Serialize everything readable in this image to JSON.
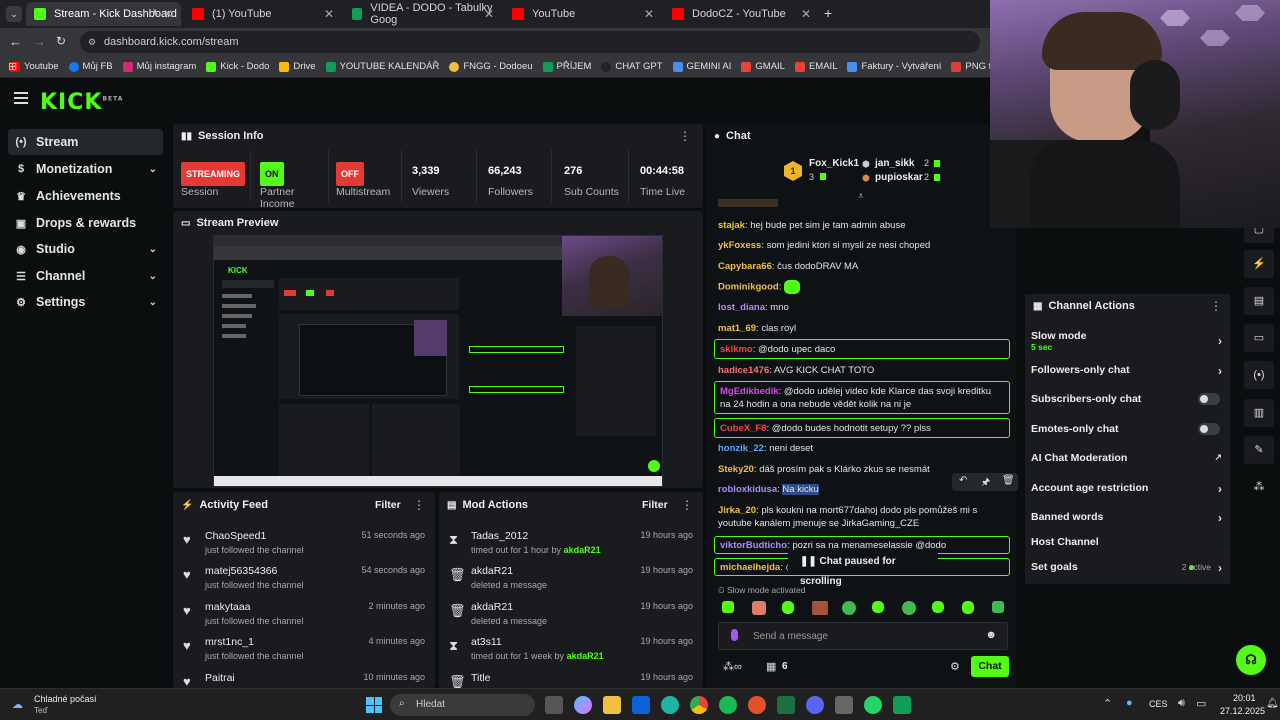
{
  "browser": {
    "tabs": [
      {
        "label": "Stream - Kick Dashboard",
        "color": "#53fc18"
      },
      {
        "label": "(1) YouTube",
        "color": "#ff0000"
      },
      {
        "label": "VIDEA - DODO - Tabulky Goog",
        "color": "#0f9d58"
      },
      {
        "label": "YouTube",
        "color": "#ff0000"
      },
      {
        "label": "DodoCZ - YouTube",
        "color": "#ff0000"
      }
    ],
    "url": "dashboard.kick.com/stream",
    "bookmarks": [
      "Youtube",
      "Můj FB",
      "Můj instagram",
      "Kick - Dodo",
      "Drive",
      "YOUTUBE KALENDÁŘ",
      "FNGG - Dodoeu",
      "PŘÍJEM",
      "CHAT GPT",
      "GEMINI AI",
      "GMAIL",
      "EMAIL",
      "Faktury - Vytváření",
      "PNG to PDF",
      "ht"
    ]
  },
  "logo": {
    "text": "KICK",
    "badge": "BETA"
  },
  "sidebar": {
    "items": [
      {
        "label": "Stream",
        "icon": "stream-icon"
      },
      {
        "label": "Monetization",
        "icon": "dollar-icon"
      },
      {
        "label": "Achievements",
        "icon": "trophy-icon"
      },
      {
        "label": "Drops & rewards",
        "icon": "gift-icon"
      },
      {
        "label": "Studio",
        "icon": "palette-icon"
      },
      {
        "label": "Channel",
        "icon": "channel-icon"
      },
      {
        "label": "Settings",
        "icon": "gear-icon"
      }
    ]
  },
  "session": {
    "title": "Session Info",
    "streaming": {
      "value": "STREAMING",
      "label": "Session"
    },
    "partner": {
      "value": "ON",
      "label": "Partner Income"
    },
    "multistream": {
      "value": "OFF",
      "label": "Multistream"
    },
    "viewers": {
      "value": "3,339",
      "label": "Viewers"
    },
    "followers": {
      "value": "66,243",
      "label": "Followers"
    },
    "subs": {
      "value": "276",
      "label": "Sub Counts"
    },
    "time": {
      "value": "00:44:58",
      "label": "Time Live"
    }
  },
  "preview": {
    "title": "Stream Preview"
  },
  "activity": {
    "title": "Activity Feed",
    "filter": "Filter",
    "rows": [
      {
        "name": "ChaoSpeed1",
        "sub": "just followed the channel",
        "time": "51 seconds ago"
      },
      {
        "name": "matej56354366",
        "sub": "just followed the channel",
        "time": "54 seconds ago"
      },
      {
        "name": "makytaaa",
        "sub": "just followed the channel",
        "time": "2 minutes ago"
      },
      {
        "name": "mrst1nc_1",
        "sub": "just followed the channel",
        "time": "4 minutes ago"
      },
      {
        "name": "Paitrai",
        "sub": "",
        "time": "10 minutes ago"
      }
    ]
  },
  "mod": {
    "title": "Mod Actions",
    "filter": "Filter",
    "rows": [
      {
        "name": "Tadas_2012",
        "sub": "timed out for 1 hour by",
        "by": "akdaR21",
        "time": "19 hours ago",
        "icon": "hourglass-icon"
      },
      {
        "name": "akdaR21",
        "sub": "deleted a message",
        "by": "",
        "time": "19 hours ago",
        "icon": "trash-icon"
      },
      {
        "name": "akdaR21",
        "sub": "deleted a message",
        "by": "",
        "time": "19 hours ago",
        "icon": "trash-icon"
      },
      {
        "name": "at3s11",
        "sub": "timed out for 1 week by",
        "by": "akdaR21",
        "time": "19 hours ago",
        "icon": "hourglass-icon"
      },
      {
        "name": "Title",
        "sub": "",
        "by": "",
        "time": "19 hours ago",
        "icon": "trash-icon"
      }
    ]
  },
  "chat": {
    "title": "Chat",
    "leaders": {
      "first": {
        "rank": "1",
        "name": "Fox_Kick1",
        "count": "3"
      },
      "second": {
        "name": "jan_sikk",
        "count": "2"
      },
      "third": {
        "name": "pupioskar",
        "count": "2"
      }
    },
    "messages": [
      {
        "user": "stajak",
        "color": "#f0c040",
        "text": "hej bude pet sim je tam admin abuse"
      },
      {
        "user": "ykFoxess",
        "color": "#f0c040",
        "text": "som jedini ktori si mysli ze nesi choped"
      },
      {
        "user": "Capybara66",
        "color": "#f0c040",
        "text": "čus dodoDRAV MA"
      },
      {
        "user": "Dominikgood",
        "color": "#f0c040",
        "text": ""
      },
      {
        "user": "lost_diana",
        "color": "#c084fc",
        "text": "mno"
      },
      {
        "user": "mat1_69",
        "color": "#f0c040",
        "text": "clas royl"
      },
      {
        "user": "skikmo",
        "color": "#ef4444",
        "text": "@dodo upec daco"
      },
      {
        "user": "hadice1476",
        "color": "#f87171",
        "text": "AVG KICK CHAT TOTO"
      },
      {
        "user": "MgEdikbedik",
        "color": "#d946ef",
        "text": "@dodo udělej video kde Klarce das svoji kreditku na 24 hodin a ona nebude vědět kolik na ni je"
      },
      {
        "user": "CubeX_F8",
        "color": "#ef4444",
        "text": "@dodo budes hodnotit setupy ?? plss"
      },
      {
        "user": "honzik_22",
        "color": "#60a5fa",
        "text": "neni deset"
      },
      {
        "user": "Steky20",
        "color": "#f0c040",
        "text": "dáš prosím pak s Klárko zkus se nesmát"
      },
      {
        "user": "robloxkidusa",
        "color": "#a78bfa",
        "text": "Na kicku"
      },
      {
        "user": "Jirka_20",
        "color": "#f0c040",
        "text": "pls koukni na mort677dahoj dodo pls pomůžeš mi s youtube kanálem jmenuje se JirkaGaming_CZE"
      },
      {
        "user": "viktorBudticho",
        "color": "#a78bfa",
        "text": "pozri sa na menameselassie @dodo"
      },
      {
        "user": "michaelhejda",
        "color": "#f0c040",
        "text": "@c"
      }
    ],
    "paused": "Chat paused for scrolling",
    "slowmode": "Slow mode activated",
    "placeholder": "Send a message",
    "viewers_count": "6",
    "chat_button": "Chat"
  },
  "actions": {
    "title": "Channel Actions",
    "items": [
      {
        "label": "Slow mode",
        "sub": "5 sec",
        "type": "chev"
      },
      {
        "label": "Followers-only chat",
        "sub": "",
        "type": "chev"
      },
      {
        "label": "Subscribers-only chat",
        "sub": "",
        "type": "toggle"
      },
      {
        "label": "Emotes-only chat",
        "sub": "",
        "type": "toggle"
      },
      {
        "label": "AI Chat Moderation",
        "sub": "",
        "type": "ext"
      },
      {
        "label": "Account age restriction",
        "sub": "",
        "type": "chev"
      },
      {
        "label": "Banned words",
        "sub": "",
        "type": "chev"
      },
      {
        "label": "Host Channel",
        "sub": "",
        "type": "none"
      },
      {
        "label": "Set goals",
        "sub": "",
        "type": "chev",
        "badge": "2 active"
      }
    ]
  },
  "taskbar": {
    "weather": "Chladné počasí",
    "weather_sub": "Teď",
    "search": "Hledat",
    "lang": "CES",
    "time": "20:01",
    "date": "27.12.2025"
  },
  "colors": {
    "accent": "#53fc18",
    "red": "#ef4444"
  }
}
